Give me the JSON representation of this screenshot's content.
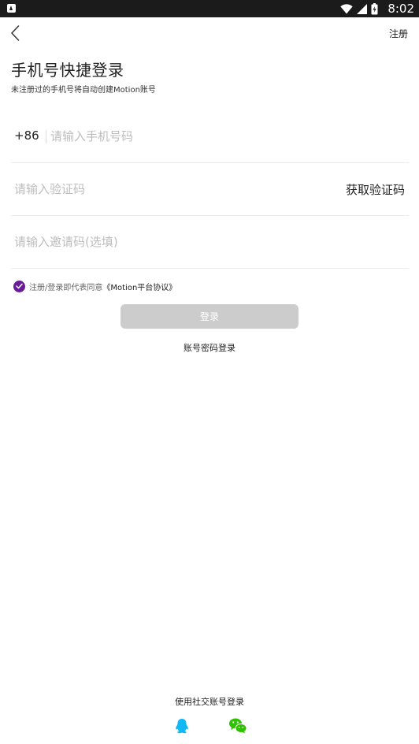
{
  "status_bar": {
    "time": "8:02",
    "icons": [
      "app-notification-icon",
      "wifi-icon",
      "cell-signal-icon",
      "battery-icon"
    ]
  },
  "nav": {
    "back_icon": "chevron-left-icon",
    "register_label": "注册"
  },
  "header": {
    "title": "手机号快捷登录",
    "subtitle": "未注册过的手机号将自动创建Motion账号"
  },
  "form": {
    "country_code": "+86",
    "phone_placeholder": "请输入手机号码",
    "phone_value": "",
    "code_placeholder": "请输入验证码",
    "code_value": "",
    "get_code_label": "获取验证码",
    "invite_placeholder": "请输入邀请码(选填)",
    "invite_value": ""
  },
  "agreement": {
    "checked": true,
    "text": "注册/登录即代表同意",
    "link_text": "《Motion平台协议》"
  },
  "actions": {
    "login_label": "登录",
    "password_login_label": "账号密码登录"
  },
  "social": {
    "title": "使用社交账号登录",
    "providers": [
      "qq-icon",
      "wechat-icon"
    ]
  },
  "colors": {
    "accent": "#6a1b9a",
    "login_button_disabled": "#cccccc",
    "qq_blue": "#12b7f5",
    "wechat_green": "#2dc100"
  }
}
